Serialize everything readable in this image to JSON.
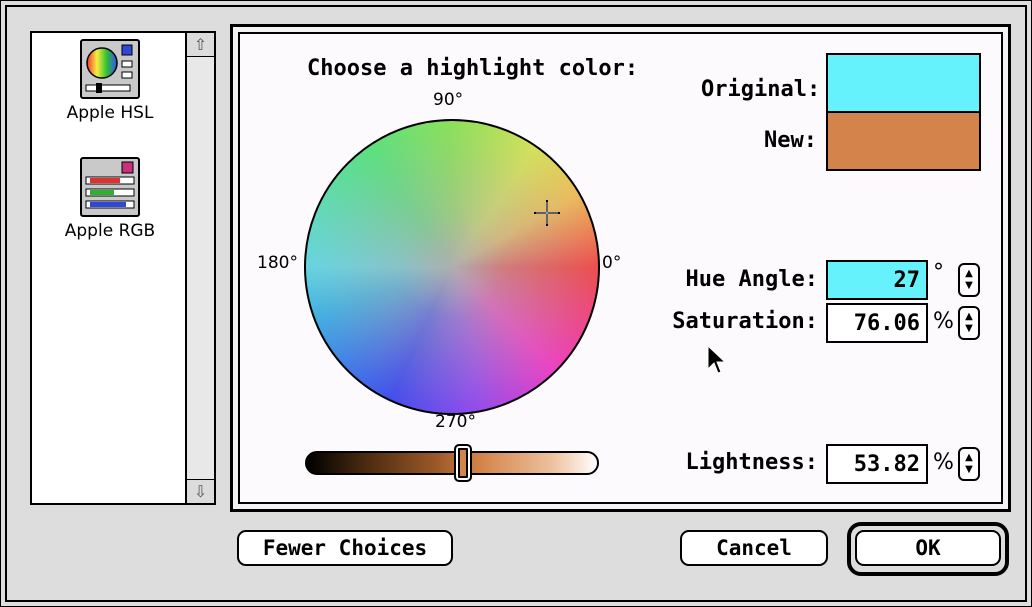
{
  "pickers": [
    {
      "label": "Apple HSL"
    },
    {
      "label": "Apple RGB"
    }
  ],
  "panel": {
    "heading": "Choose a highlight color:",
    "wheel_labels": {
      "top": "90°",
      "left": "180°",
      "right": "0°",
      "bottom": "270°"
    },
    "original_label": "Original:",
    "new_label": "New:",
    "original_color": "#66f2fc",
    "new_color": "#d4844a"
  },
  "fields": {
    "hue": {
      "label": "Hue Angle:",
      "value": "27",
      "unit": "°"
    },
    "saturation": {
      "label": "Saturation:",
      "value": "76.06",
      "unit": "%"
    },
    "lightness": {
      "label": "Lightness:",
      "value": "53.82",
      "unit": "%"
    }
  },
  "lightness_slider": {
    "value_percent": 53.82
  },
  "buttons": {
    "fewer_choices": "Fewer Choices",
    "cancel": "Cancel",
    "ok": "OK"
  }
}
